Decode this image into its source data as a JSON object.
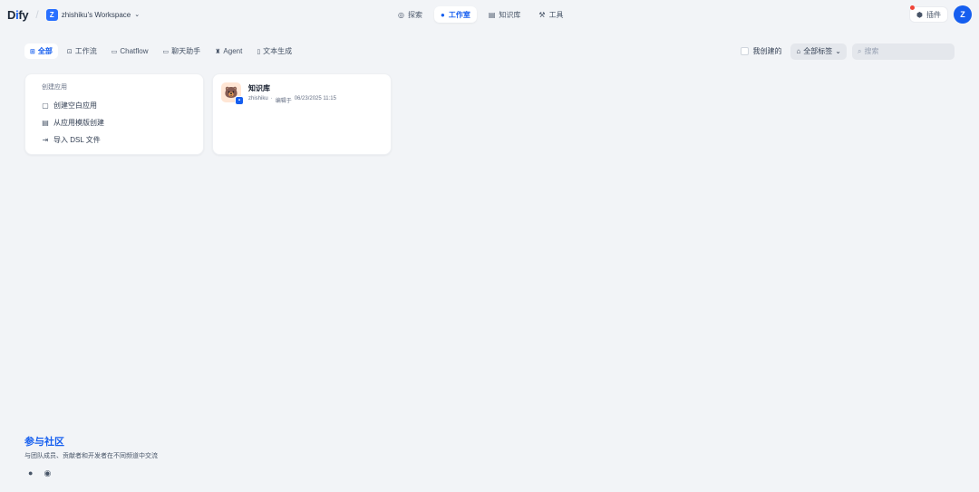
{
  "header": {
    "logo_pre": "D",
    "logo_accent": "i",
    "logo_post": "fy",
    "workspace_initial": "Z",
    "workspace_name": "zhishiku's Workspace",
    "nav": [
      {
        "label": "探索",
        "icon": "compass-icon"
      },
      {
        "label": "工作室",
        "icon": "robot-icon"
      },
      {
        "label": "知识库",
        "icon": "book-icon"
      },
      {
        "label": "工具",
        "icon": "wrench-icon"
      }
    ],
    "plugin_label": "插件",
    "avatar_initial": "Z"
  },
  "filters": {
    "tabs": [
      {
        "label": "全部",
        "icon": "grid-icon"
      },
      {
        "label": "工作流",
        "icon": "workflow-icon"
      },
      {
        "label": "Chatflow",
        "icon": "chatflow-icon"
      },
      {
        "label": "聊天助手",
        "icon": "chat-icon"
      },
      {
        "label": "Agent",
        "icon": "agent-icon"
      },
      {
        "label": "文本生成",
        "icon": "text-icon"
      }
    ],
    "created_by_me": "我创建的",
    "tags_label": "全部标签",
    "search_placeholder": "搜索"
  },
  "create_card": {
    "title": "创建应用",
    "items": [
      {
        "label": "创建空白应用",
        "icon": "file-plus-icon"
      },
      {
        "label": "从应用模版创建",
        "icon": "template-icon"
      },
      {
        "label": "导入 DSL 文件",
        "icon": "import-icon"
      }
    ]
  },
  "app": {
    "name": "知识库",
    "author": "zhishiku",
    "edited_label": "编辑于",
    "edited_time": "06/23/2025 11:15"
  },
  "community": {
    "title": "参与社区",
    "description": "与团队成员、贡献者和开发者在不同频道中交流",
    "icons": [
      "github-icon",
      "discord-icon"
    ]
  },
  "colors": {
    "accent": "#155eef",
    "background": "#f2f4f7",
    "notification": "#f04438"
  }
}
